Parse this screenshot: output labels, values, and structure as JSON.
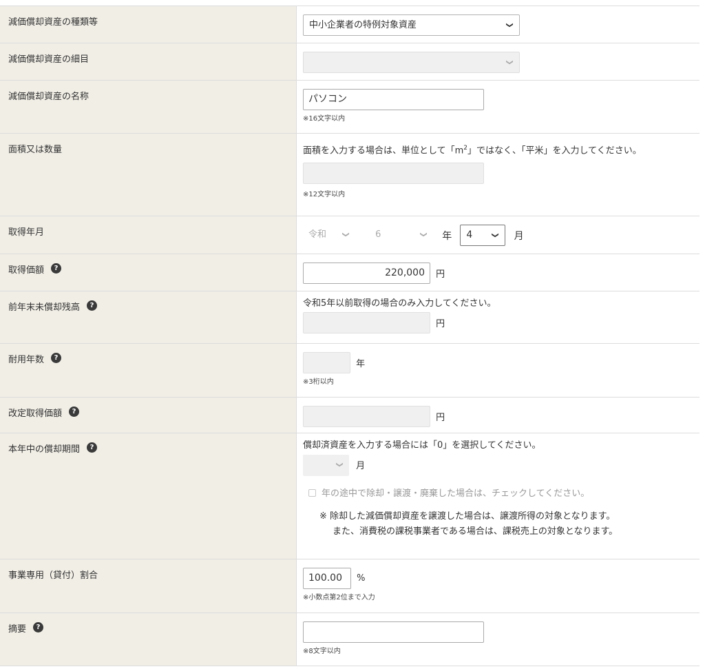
{
  "rows": {
    "asset_type": {
      "label": "減価償却資産の種類等",
      "selected": "中小企業者の特例対象資産"
    },
    "asset_detail": {
      "label": "減価償却資産の細目",
      "selected": ""
    },
    "asset_name": {
      "label": "減価償却資産の名称",
      "value": "パソコン",
      "note": "※16文字以内"
    },
    "area_quantity": {
      "label": "面積又は数量",
      "instruction_pre": "面積を入力する場合は、単位として「m",
      "instruction_sup": "2",
      "instruction_post": "」ではなく、「平米」を入力してください。",
      "value": "",
      "note": "※12文字以内"
    },
    "acquisition_date": {
      "label": "取得年月",
      "era": "令和",
      "year": "6",
      "year_unit": "年",
      "month": "4",
      "month_unit": "月"
    },
    "acquisition_price": {
      "label": "取得価額",
      "value": "220,000",
      "unit": "円"
    },
    "prev_balance": {
      "label": "前年末未償却残高",
      "instruction": "令和5年以前取得の場合のみ入力してください。",
      "value": "",
      "unit": "円"
    },
    "useful_life": {
      "label": "耐用年数",
      "value": "",
      "unit": "年",
      "note": "※3桁以内"
    },
    "revised_price": {
      "label": "改定取得価額",
      "value": "",
      "unit": "円"
    },
    "depreciation_period": {
      "label": "本年中の償却期間",
      "instruction": "償却済資産を入力する場合には「0」を選択してください。",
      "selected": "",
      "unit": "月",
      "checkbox_label": "年の途中で除却・譲渡・廃棄した場合は、チェックしてください。",
      "warning_line1": "※ 除却した減価償却資産を譲渡した場合は、譲渡所得の対象となります。",
      "warning_line2": "また、消費税の課税事業者である場合は、課税売上の対象となります。"
    },
    "business_ratio": {
      "label": "事業専用（貸付）割合",
      "value": "100.00",
      "unit": "%",
      "note": "※小数点第2位まで入力"
    },
    "remarks": {
      "label": "摘要",
      "value": "",
      "note": "※8文字以内"
    }
  },
  "icons": {
    "help": "?",
    "chevron": "❯"
  },
  "colors": {
    "label_bg": "#f1eee6",
    "border": "#dcdcdc",
    "disabled_bg": "#f0f0f0"
  }
}
